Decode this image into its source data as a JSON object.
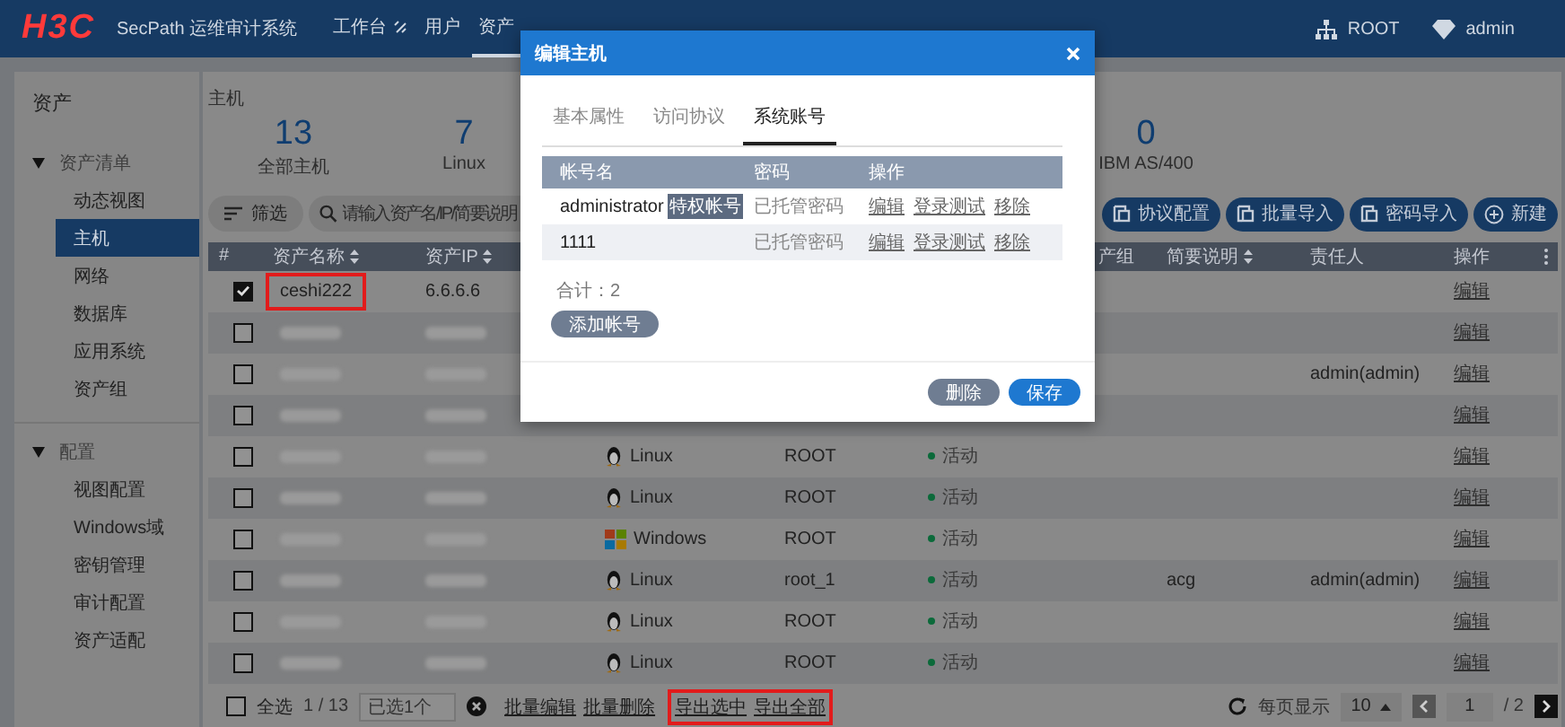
{
  "header": {
    "logo": "H3C",
    "product": "SecPath 运维审计系统",
    "nav": [
      {
        "label": "工作台",
        "has_icon": true,
        "selected": false
      },
      {
        "label": "用户",
        "has_icon": false,
        "selected": false
      },
      {
        "label": "资产",
        "has_icon": false,
        "selected": true
      }
    ],
    "org": "ROOT",
    "user": "admin"
  },
  "sidebar": {
    "title": "资产",
    "groups": [
      {
        "label": "资产清单",
        "expanded": true,
        "items": [
          {
            "label": "动态视图",
            "selected": false
          },
          {
            "label": "主机",
            "selected": true
          },
          {
            "label": "网络",
            "selected": false
          },
          {
            "label": "数据库",
            "selected": false
          },
          {
            "label": "应用系统",
            "selected": false
          },
          {
            "label": "资产组",
            "selected": false
          }
        ]
      },
      {
        "label": "配置",
        "expanded": true,
        "items": [
          {
            "label": "视图配置",
            "selected": false
          },
          {
            "label": "Windows域",
            "selected": false
          },
          {
            "label": "密钥管理",
            "selected": false
          },
          {
            "label": "审计配置",
            "selected": false
          },
          {
            "label": "资产适配",
            "selected": false
          }
        ]
      }
    ]
  },
  "main": {
    "title": "主机",
    "stats": [
      {
        "value": "13",
        "label": "全部主机"
      },
      {
        "value": "7",
        "label": "Linux"
      },
      {
        "value": "0",
        "label": "IBM AS/400"
      }
    ],
    "filter_button": "筛选",
    "search": {
      "placeholder": "请输入资产名/IP/简要说明"
    },
    "actions": [
      {
        "label": "协议配置",
        "kind": "import"
      },
      {
        "label": "批量导入",
        "kind": "import"
      },
      {
        "label": "密码导入",
        "kind": "import"
      },
      {
        "label": "新建",
        "kind": "add"
      }
    ],
    "table": {
      "columns": [
        {
          "label": "#",
          "sortable": false
        },
        {
          "label": "资产名称",
          "sortable": true
        },
        {
          "label": "资产IP",
          "sortable": true
        },
        {
          "label": "产组",
          "sortable": false
        },
        {
          "label": "简要说明",
          "sortable": true
        },
        {
          "label": "责任人",
          "sortable": false
        },
        {
          "label": "操作",
          "sortable": false
        }
      ],
      "rows": [
        {
          "checked": true,
          "highlighted": true,
          "redacted": false,
          "name": "ceshi222",
          "ip": "6.6.6.6",
          "action": "编辑"
        },
        {
          "checked": false,
          "highlighted": false,
          "redacted": true,
          "action": "编辑"
        },
        {
          "checked": false,
          "highlighted": false,
          "redacted": true,
          "owner": "admin(admin)",
          "action": "编辑"
        },
        {
          "checked": false,
          "highlighted": false,
          "redacted": true,
          "action": "编辑"
        },
        {
          "checked": false,
          "highlighted": false,
          "redacted": true,
          "os": {
            "label": "Linux",
            "kind": "linux"
          },
          "account": "ROOT",
          "status": "活动",
          "action": "编辑"
        },
        {
          "checked": false,
          "highlighted": false,
          "redacted": true,
          "os": {
            "label": "Linux",
            "kind": "linux"
          },
          "account": "ROOT",
          "status": "活动",
          "action": "编辑"
        },
        {
          "checked": false,
          "highlighted": false,
          "redacted": true,
          "os": {
            "label": "Windows",
            "kind": "windows"
          },
          "account": "ROOT",
          "status": "活动",
          "action": "编辑"
        },
        {
          "checked": false,
          "highlighted": false,
          "redacted": true,
          "os": {
            "label": "Linux",
            "kind": "linux"
          },
          "account": "root_1",
          "status": "活动",
          "note": "acg",
          "owner": "admin(admin)",
          "action": "编辑"
        },
        {
          "checked": false,
          "highlighted": false,
          "redacted": true,
          "os": {
            "label": "Linux",
            "kind": "linux"
          },
          "account": "ROOT",
          "status": "活动",
          "action": "编辑"
        },
        {
          "checked": false,
          "highlighted": false,
          "redacted": true,
          "os": {
            "label": "Linux",
            "kind": "linux"
          },
          "account": "ROOT",
          "status": "活动",
          "action": "编辑"
        }
      ]
    },
    "footer": {
      "select_all": {
        "label": "全选",
        "checked": false
      },
      "count": "1 / 13",
      "selected_field": "已选1个",
      "links": [
        {
          "label": "批量编辑",
          "highlighted": false
        },
        {
          "label": "批量删除",
          "highlighted": false
        },
        {
          "label": "导出选中",
          "highlighted": true
        },
        {
          "label": "导出全部",
          "highlighted": true
        }
      ],
      "page_size_label": "每页显示",
      "page_size": "10",
      "page": "1",
      "total_pages": "/ 2"
    }
  },
  "dialog": {
    "title": "编辑主机",
    "tabs": [
      {
        "label": "基本属性",
        "selected": false
      },
      {
        "label": "访问协议",
        "selected": false
      },
      {
        "label": "系统账号",
        "selected": true
      }
    ],
    "columns": [
      "帐号名",
      "密码",
      "操作"
    ],
    "rows": [
      {
        "name": "administrator",
        "tag": "特权帐号",
        "password": "已托管密码",
        "actions": [
          "编辑",
          "登录测试",
          "移除"
        ]
      },
      {
        "name": "1111",
        "password": "已托管密码",
        "actions": [
          "编辑",
          "登录测试",
          "移除"
        ]
      }
    ],
    "total": "合计：2",
    "add_button": "添加帐号",
    "buttons": [
      {
        "label": "删除",
        "kind": "secondary"
      },
      {
        "label": "保存",
        "kind": "primary"
      }
    ]
  }
}
